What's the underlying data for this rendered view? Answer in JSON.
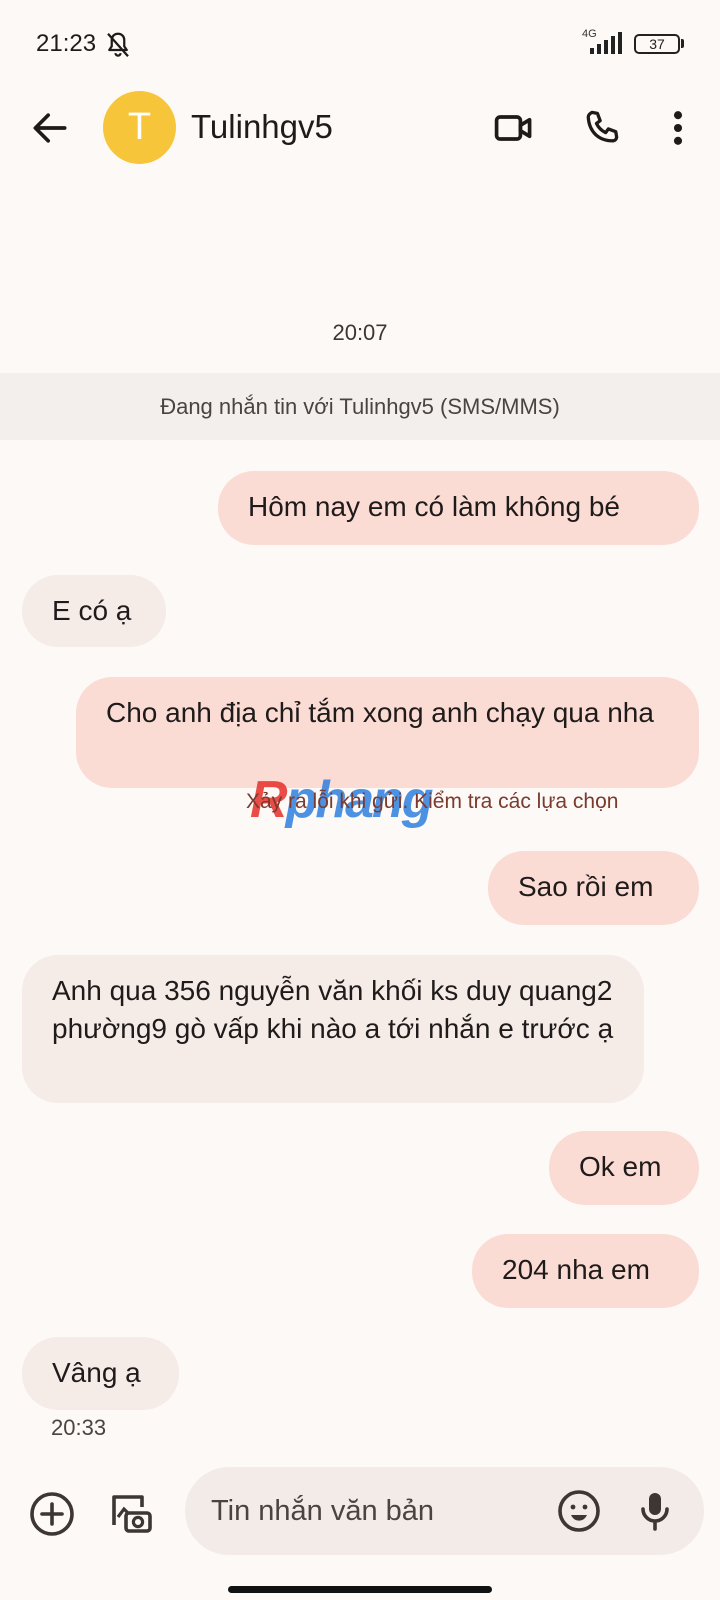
{
  "status_bar": {
    "time": "21:23",
    "network": "4G",
    "battery": "37",
    "icons": [
      "notifications-off-icon",
      "signal-icon",
      "battery-icon"
    ]
  },
  "header": {
    "avatar_letter": "T",
    "avatar_color": "#f7c53a",
    "contact_name": "Tulinhgv5",
    "icons": [
      "back-arrow-icon",
      "video-call-icon",
      "phone-icon",
      "more-vert-icon"
    ]
  },
  "conversation": {
    "date_stamp": "20:07",
    "banner": "Đang nhắn tin với Tulinhgv5 (SMS/MMS)",
    "messages": [
      {
        "direction": "outgoing",
        "text": "Hôm nay em có làm không bé"
      },
      {
        "direction": "incoming",
        "text": "E có ạ"
      },
      {
        "direction": "outgoing",
        "text": "Cho anh địa chỉ tắm xong anh chạy qua nha"
      },
      {
        "direction": "outgoing",
        "text": "Sao rồi em"
      },
      {
        "direction": "incoming",
        "text": "Anh qua 356 nguyễn văn khối ks duy quang2 phường9 gò vấp khi nào a tới nhắn e trước ạ"
      },
      {
        "direction": "outgoing",
        "text": "Ok em"
      },
      {
        "direction": "outgoing",
        "text": "204 nha em"
      },
      {
        "direction": "incoming",
        "text": "Vâng ạ"
      }
    ],
    "send_error": "Xảy ra lỗi khi gửi. Kiểm tra các lựa chọn",
    "last_time": "20:33"
  },
  "watermark": {
    "part1": "R",
    "part2": "phang"
  },
  "compose": {
    "placeholder": "Tin nhắn văn bản",
    "icons": [
      "add-circle-icon",
      "gallery-icon",
      "emoji-icon",
      "mic-icon"
    ]
  },
  "colors": {
    "outgoing_bubble": "#fbdcd5",
    "incoming_bubble": "#f5ebe7",
    "background": "#fcf9f7"
  }
}
